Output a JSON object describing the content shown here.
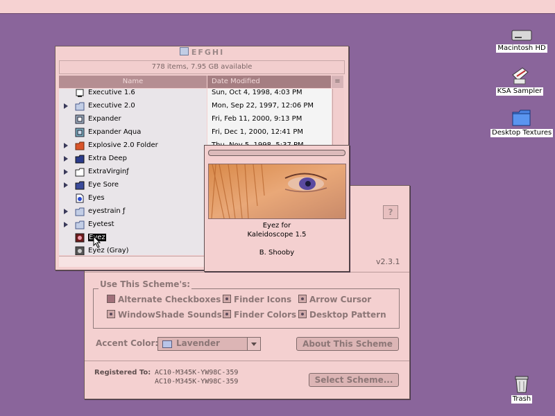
{
  "desktop": {
    "icons": [
      {
        "label": "Macintosh HD",
        "icon": "hard-drive-icon"
      },
      {
        "label": "KSA Sampler",
        "icon": "document-icon"
      },
      {
        "label": "Desktop Textures",
        "icon": "folder-icon"
      },
      {
        "label": "Trash",
        "icon": "trash-icon"
      }
    ]
  },
  "finder": {
    "title": "EFGHI",
    "info": "778 items, 7.95 GB available",
    "columns": {
      "name": "Name",
      "date": "Date Modified"
    },
    "rows": [
      {
        "name": "Executive 1.6",
        "date": "Sun, Oct 4, 1998, 4:03 PM",
        "icon": "application-icon",
        "expandable": false
      },
      {
        "name": "Executive 2.0",
        "date": "Mon, Sep 22, 1997, 12:06 PM",
        "icon": "folder-icon",
        "expandable": true
      },
      {
        "name": "Expander",
        "date": "Fri, Feb 11, 2000, 9:13 PM",
        "icon": "application-icon",
        "expandable": false
      },
      {
        "name": "Expander Aqua",
        "date": "Fri, Dec 1, 2000, 12:41 PM",
        "icon": "application-icon",
        "expandable": false
      },
      {
        "name": "Explosive 2.0 Folder",
        "date": "Thu, Nov 5, 1998, 5:37 PM",
        "icon": "folder-icon",
        "expandable": true
      },
      {
        "name": "Extra Deep",
        "date": "",
        "icon": "folder-icon",
        "expandable": true
      },
      {
        "name": "ExtraVirginƒ",
        "date": "",
        "icon": "folder-icon",
        "expandable": true
      },
      {
        "name": "Eye Sore",
        "date": "",
        "icon": "folder-icon",
        "expandable": true
      },
      {
        "name": "Eyes",
        "date": "",
        "icon": "document-icon",
        "expandable": false
      },
      {
        "name": "eyestrain ƒ",
        "date": "",
        "icon": "folder-icon",
        "expandable": true
      },
      {
        "name": "Eyetest",
        "date": "",
        "icon": "folder-icon",
        "expandable": true
      },
      {
        "name": "Eyez",
        "date": "",
        "icon": "scheme-icon",
        "expandable": false,
        "selected": true
      },
      {
        "name": "Eyez (Gray)",
        "date": "",
        "icon": "scheme-icon",
        "expandable": false
      }
    ]
  },
  "popup": {
    "line1": "Eyez for",
    "line2": "Kaleidoscope 1.5",
    "author": "B. Shooby"
  },
  "kaleidoscope": {
    "version": "v2.3.1",
    "help": "?",
    "use_scheme_title": "Use This Scheme's:",
    "options": {
      "alt_checkboxes": "Alternate Checkboxes",
      "finder_icons": "Finder Icons",
      "arrow_cursor": "Arrow Cursor",
      "windowshade_sounds": "WindowShade Sounds",
      "finder_colors": "Finder Colors",
      "desktop_pattern": "Desktop Pattern"
    },
    "accent_label": "Accent Color:",
    "accent_value": "Lavender",
    "about_button": "About This Scheme",
    "registered_label": "Registered To:",
    "registration_line1": "AC10-M345K-YW98C-359",
    "registration_line2": "AC10-M345K-YW98C-359",
    "select_button": "Select Scheme..."
  },
  "colors": {
    "desktop": "#8a659b",
    "window": "#f4d0d0",
    "header": "#b58e92"
  }
}
